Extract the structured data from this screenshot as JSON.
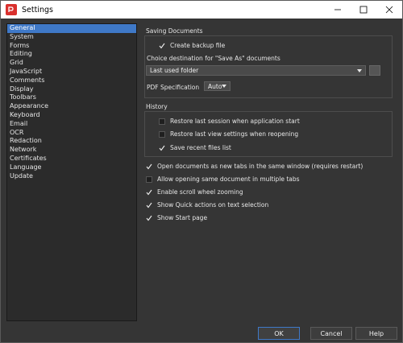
{
  "window": {
    "title": "Settings"
  },
  "sidebar": {
    "items": [
      {
        "label": "General",
        "selected": true
      },
      {
        "label": "System"
      },
      {
        "label": "Forms"
      },
      {
        "label": "Editing"
      },
      {
        "label": "Grid"
      },
      {
        "label": "JavaScript"
      },
      {
        "label": "Comments"
      },
      {
        "label": "Display"
      },
      {
        "label": "Toolbars"
      },
      {
        "label": "Appearance"
      },
      {
        "label": "Keyboard"
      },
      {
        "label": "Email"
      },
      {
        "label": "OCR"
      },
      {
        "label": "Redaction"
      },
      {
        "label": "Network"
      },
      {
        "label": "Certificates"
      },
      {
        "label": "Language"
      },
      {
        "label": "Update"
      }
    ]
  },
  "saving": {
    "heading": "Saving Documents",
    "create_backup_label": "Create backup file",
    "create_backup_checked": true,
    "choice_label": "Choice destination for \"Save As\" documents",
    "destination_value": "Last used folder",
    "pdf_spec_label": "PDF Specification",
    "pdf_spec_value": "Auto"
  },
  "history": {
    "heading": "History",
    "items": [
      {
        "label": "Restore last session when application start",
        "checked": false
      },
      {
        "label": "Restore last view settings when reopening",
        "checked": false
      },
      {
        "label": "Save recent files list",
        "checked": true
      }
    ]
  },
  "options": [
    {
      "label": "Open documents as new tabs in the same window (requires restart)",
      "checked": true
    },
    {
      "label": "Allow opening same document in multiple tabs",
      "checked": false
    },
    {
      "label": "Enable scroll wheel zooming",
      "checked": true
    },
    {
      "label": "Show Quick actions on text selection",
      "checked": true
    },
    {
      "label": "Show Start page",
      "checked": true
    }
  ],
  "buttons": {
    "ok": "OK",
    "cancel": "Cancel",
    "help": "Help"
  },
  "colors": {
    "background": "#353535",
    "selection": "#3f79c8",
    "brand": "#d9302d"
  }
}
